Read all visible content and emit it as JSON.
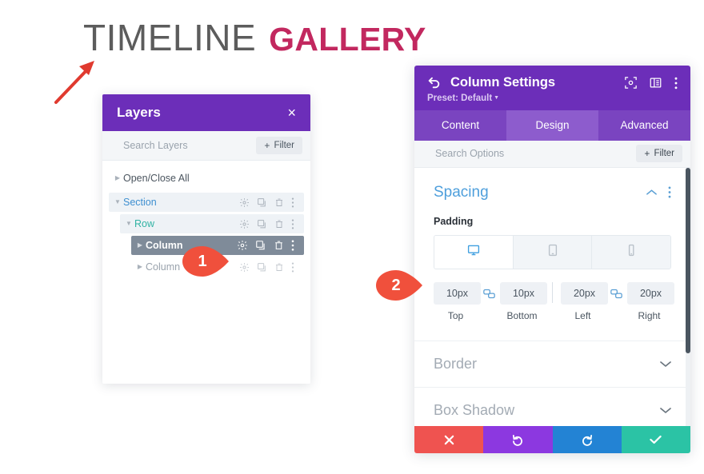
{
  "title": {
    "primary": "TIMELINE",
    "accent": "GALLERY",
    "primary_color": "#5c5c5c",
    "accent_color": "#c2285f"
  },
  "annotations": {
    "arrow": "red-up-right-arrow",
    "markers": [
      {
        "number": "1",
        "color": "#f0503c"
      },
      {
        "number": "2",
        "color": "#f0503c"
      }
    ]
  },
  "layers_panel": {
    "title": "Layers",
    "close_label": "×",
    "search": {
      "placeholder": "Search Layers",
      "value": ""
    },
    "filter_button": {
      "plus": "+",
      "label": "Filter"
    },
    "tree": [
      {
        "label": "Open/Close All",
        "type": "root",
        "caret": "right",
        "icons": []
      },
      {
        "label": "Section",
        "type": "section",
        "caret": "down",
        "icons": [
          "gear-icon",
          "duplicate-icon",
          "trash-icon",
          "more-vertical-icon"
        ]
      },
      {
        "label": "Row",
        "type": "row",
        "caret": "down",
        "icons": [
          "gear-icon",
          "duplicate-icon",
          "trash-icon",
          "more-vertical-icon"
        ]
      },
      {
        "label": "Column",
        "type": "column-selected",
        "caret": "right",
        "icons": [
          "gear-icon",
          "duplicate-icon",
          "trash-icon",
          "more-vertical-icon"
        ]
      },
      {
        "label": "Column",
        "type": "column",
        "caret": "right",
        "icons": [
          "gear-icon",
          "duplicate-icon",
          "trash-icon",
          "more-vertical-icon"
        ]
      }
    ]
  },
  "settings_panel": {
    "title": "Column Settings",
    "preset": "Preset: Default",
    "header_icons": [
      "focus-target-icon",
      "split-panel-icon",
      "more-vertical-icon"
    ],
    "back_icon": "back-arrow-icon",
    "tabs": [
      {
        "label": "Content",
        "active": false
      },
      {
        "label": "Design",
        "active": true
      },
      {
        "label": "Advanced",
        "active": false
      }
    ],
    "search": {
      "placeholder": "Search Options",
      "value": ""
    },
    "filter_button": {
      "plus": "+",
      "label": "Filter"
    },
    "spacing": {
      "title": "Spacing",
      "collapse_icon": "chevron-up-icon",
      "more_icon": "more-vertical-icon",
      "field_label": "Padding",
      "devices": [
        {
          "name": "desktop-icon",
          "active": true
        },
        {
          "name": "tablet-icon",
          "active": false
        },
        {
          "name": "phone-icon",
          "active": false
        }
      ],
      "padding": [
        {
          "value": "10px",
          "name": "Top"
        },
        {
          "value": "10px",
          "name": "Bottom"
        },
        {
          "value": "20px",
          "name": "Left"
        },
        {
          "value": "20px",
          "name": "Right"
        }
      ],
      "link_icon": "link-icon"
    },
    "collapsed_sections": [
      {
        "title": "Border",
        "chevron": "chevron-down-icon"
      },
      {
        "title": "Box Shadow",
        "chevron": "chevron-down-icon"
      }
    ],
    "footer": [
      {
        "name": "cancel-button",
        "glyph": "✕",
        "color": "#ef5350"
      },
      {
        "name": "undo-button",
        "glyph": "↺",
        "color": "#8c38e0"
      },
      {
        "name": "redo-button",
        "glyph": "↻",
        "color": "#2383d4"
      },
      {
        "name": "save-button",
        "glyph": "✓",
        "color": "#2bc3a5"
      }
    ]
  }
}
